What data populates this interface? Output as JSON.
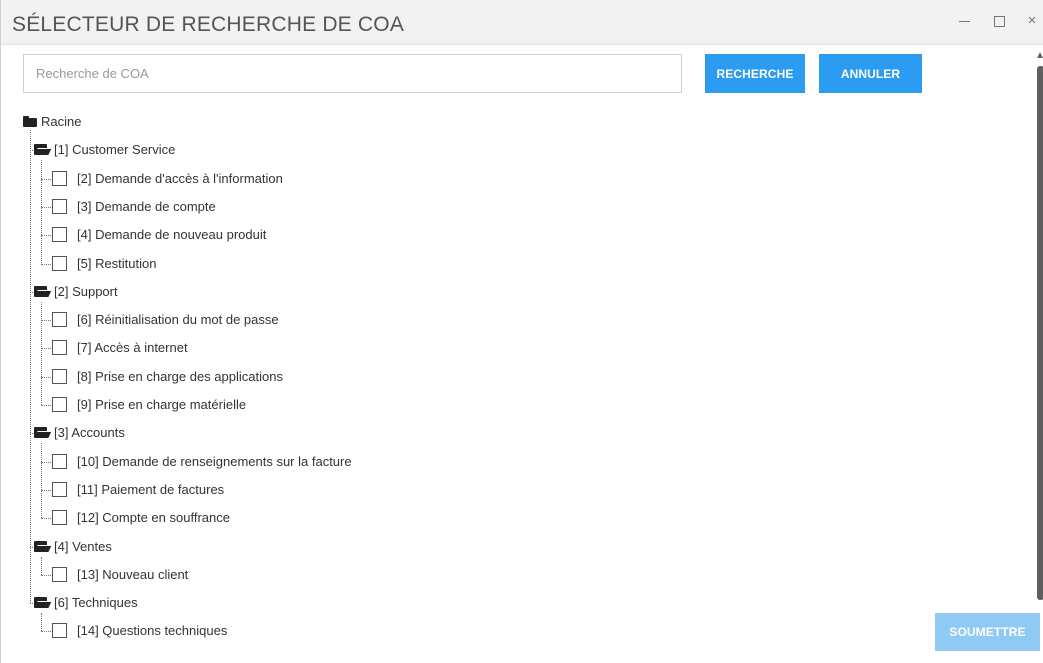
{
  "window": {
    "title": "SÉLECTEUR DE RECHERCHE DE COA",
    "minimize_icon": "minimize-icon",
    "maximize_icon": "maximize-icon",
    "close_label": "×"
  },
  "search": {
    "placeholder": "Recherche de COA",
    "value": "",
    "search_label": "RECHERCHE",
    "cancel_label": "ANNULER"
  },
  "tree": {
    "root": {
      "label": "Racine",
      "icon": "folder-closed-icon"
    },
    "groups": [
      {
        "label": "[1] Customer Service",
        "icon": "folder-open-icon",
        "items": [
          {
            "label": "[2] Demande d'accès à l'information",
            "checked": false
          },
          {
            "label": "[3] Demande de compte",
            "checked": false
          },
          {
            "label": "[4] Demande de nouveau produit",
            "checked": false
          },
          {
            "label": "[5] Restitution",
            "checked": false
          }
        ]
      },
      {
        "label": "[2] Support",
        "icon": "folder-open-icon",
        "items": [
          {
            "label": "[6] Réinitialisation du mot de passe",
            "checked": false
          },
          {
            "label": "[7] Accès à internet",
            "checked": false
          },
          {
            "label": "[8] Prise en charge des applications",
            "checked": false
          },
          {
            "label": "[9] Prise en charge matérielle",
            "checked": false
          }
        ]
      },
      {
        "label": "[3] Accounts",
        "icon": "folder-open-icon",
        "items": [
          {
            "label": "[10] Demande de renseignements sur la facture",
            "checked": false
          },
          {
            "label": "[11] Paiement de factures",
            "checked": false
          },
          {
            "label": "[12] Compte en souffrance",
            "checked": false
          }
        ]
      },
      {
        "label": "[4] Ventes",
        "icon": "folder-open-icon",
        "items": [
          {
            "label": "[13] Nouveau client",
            "checked": false
          }
        ]
      },
      {
        "label": "[6] Techniques",
        "icon": "folder-open-icon",
        "items": [
          {
            "label": "[14] Questions techniques",
            "checked": false
          }
        ]
      }
    ]
  },
  "footer": {
    "submit_label": "SOUMETTRE",
    "submit_enabled": false
  },
  "colors": {
    "primary_button": "#2b9cf2",
    "disabled_button": "#8fcaf5",
    "titlebar_bg": "#f2f2f2"
  }
}
